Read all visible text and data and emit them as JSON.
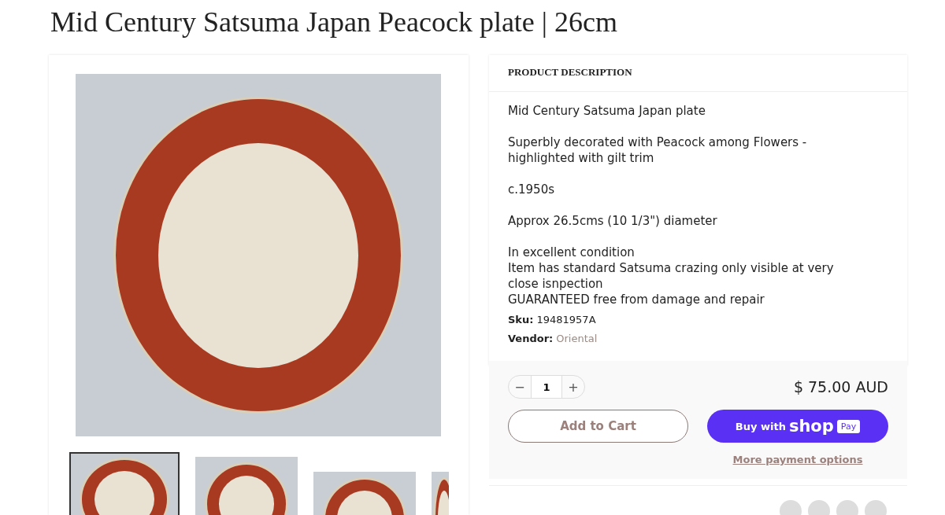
{
  "title": "Mid Century Satsuma Japan Peacock plate | 26cm",
  "thumbnails": [
    {
      "selected": true
    },
    {
      "selected": false
    },
    {
      "selected": false
    },
    {
      "selected": false
    }
  ],
  "description": {
    "heading": "PRODUCT DESCRIPTION",
    "paragraphs": [
      [
        "Mid Century Satsuma Japan plate"
      ],
      [
        "Superbly decorated with Peacock among Flowers - highlighted with gilt trim"
      ],
      [
        "c.1950s"
      ],
      [
        "Approx 26.5cms (10 1/3\") diameter"
      ],
      [
        "In excellent condition",
        "Item has standard Satsuma crazing only visible at very close isnpection",
        "GUARANTEED free from damage and repair"
      ]
    ],
    "meta": [
      {
        "label": "Sku:",
        "value": "19481957A",
        "kind": "plain"
      },
      {
        "label": "Vendor:",
        "value": "Oriental",
        "kind": "link"
      }
    ]
  },
  "purchase": {
    "quantity": "1",
    "minus": "−",
    "plus": "+",
    "price": "$ 75.00 AUD",
    "add_to_cart": "Add to Cart",
    "buy_with": "Buy with",
    "shop": "shop",
    "pay": "Pay",
    "more_options": "More payment options"
  }
}
